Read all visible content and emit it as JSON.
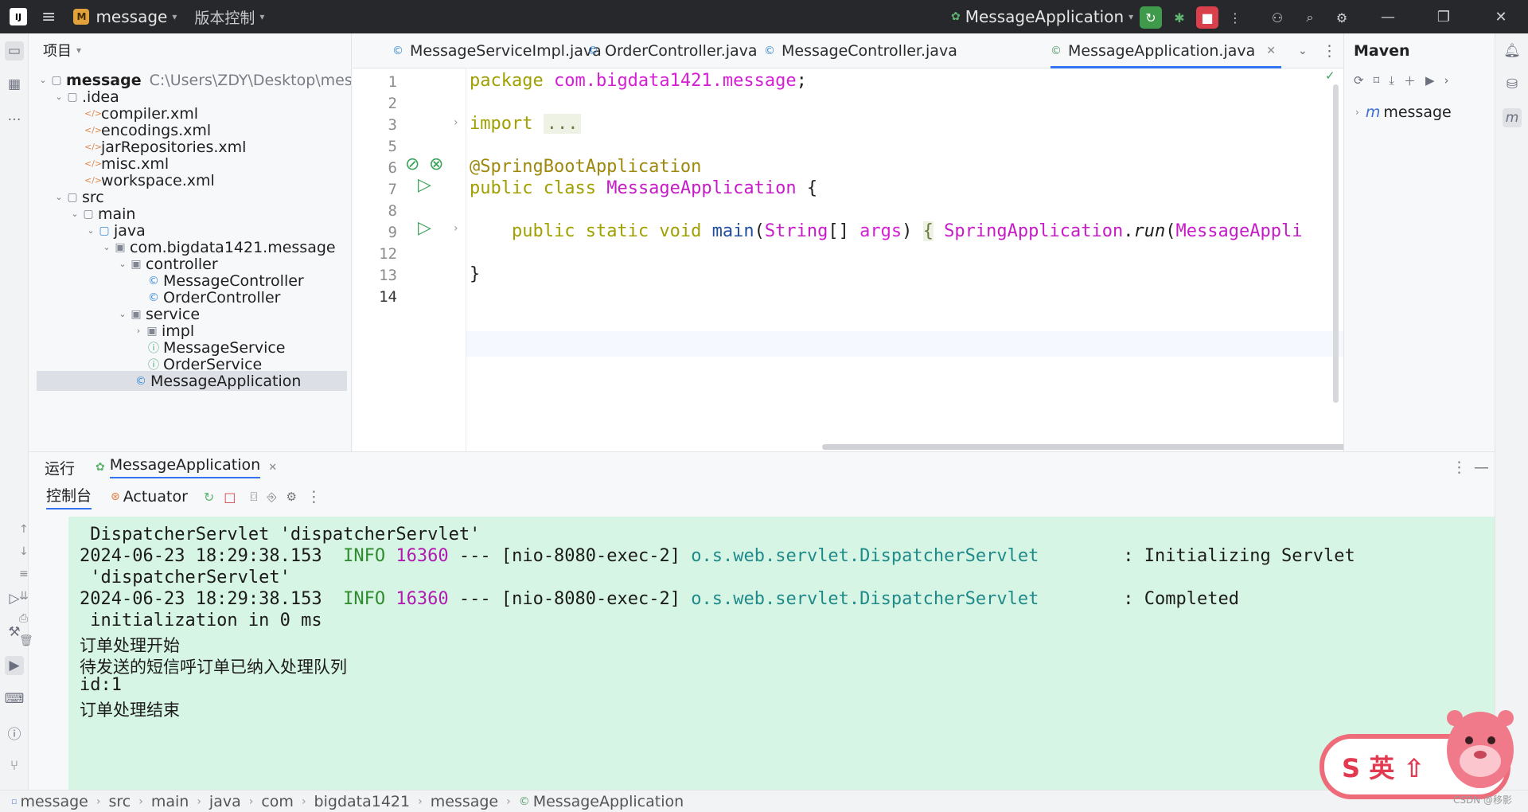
{
  "titlebar": {
    "app_logo": "IJ",
    "project_badge": "M",
    "project_name": "message",
    "vcs_label": "版本控制",
    "run_config": "MessageApplication",
    "icons": [
      "menu-icon",
      "rerun-icon",
      "debug-icon",
      "stop-icon",
      "more-icon",
      "add-user-icon",
      "search-icon",
      "settings-icon",
      "minimize-icon",
      "restore-icon",
      "close-icon"
    ]
  },
  "project": {
    "header": "项目",
    "tree": [
      {
        "label": "message",
        "path": "C:\\Users\\ZDY\\Desktop\\mes",
        "icon": "folder"
      },
      {
        "label": ".idea",
        "icon": "folder"
      },
      {
        "label": "compiler.xml",
        "icon": "xml"
      },
      {
        "label": "encodings.xml",
        "icon": "xml"
      },
      {
        "label": "jarRepositories.xml",
        "icon": "xml"
      },
      {
        "label": "misc.xml",
        "icon": "xml"
      },
      {
        "label": "workspace.xml",
        "icon": "xml"
      },
      {
        "label": "src",
        "icon": "folder"
      },
      {
        "label": "main",
        "icon": "folder"
      },
      {
        "label": "java",
        "icon": "folder"
      },
      {
        "label": "com.bigdata1421.message",
        "icon": "package"
      },
      {
        "label": "controller",
        "icon": "package"
      },
      {
        "label": "MessageController",
        "icon": "class"
      },
      {
        "label": "OrderController",
        "icon": "class"
      },
      {
        "label": "service",
        "icon": "package"
      },
      {
        "label": "impl",
        "icon": "package"
      },
      {
        "label": "MessageService",
        "icon": "interface"
      },
      {
        "label": "OrderService",
        "icon": "interface"
      },
      {
        "label": "MessageApplication",
        "icon": "class"
      }
    ]
  },
  "editor": {
    "tabs": [
      {
        "label": "MessageServiceImpl.java"
      },
      {
        "label": "OrderController.java"
      },
      {
        "label": "MessageController.java"
      },
      {
        "label": "MessageApplication.java",
        "active": true
      }
    ],
    "line_numbers": [
      "1",
      "2",
      "3",
      "5",
      "6",
      "7",
      "8",
      "9",
      "12",
      "13",
      "14"
    ],
    "code": {
      "l1_kw": "package",
      "l1_pkg": "com.bigdata1421.message",
      "l1_end": ";",
      "l3_kw": "import",
      "l3_fold": "...",
      "l6_ann": "@SpringBootApplication",
      "l7_kw": "public class",
      "l7_cls": "MessageApplication",
      "l7_end": "{",
      "l9_kw": "public static void",
      "l9_fn": "main",
      "l9_p1": "(",
      "l9_type": "String",
      "l9_p2": "[] ",
      "l9_arg": "args",
      "l9_p3": ") ",
      "l9_brace": "{",
      "l9_sp": " SpringApplication",
      "l9_dot": ".",
      "l9_run": "run",
      "l9_p4": "(",
      "l9_tail": "MessageAppli",
      "l13": "}"
    }
  },
  "maven": {
    "title": "Maven",
    "item": "message"
  },
  "run": {
    "label": "运行",
    "config_tab": "MessageApplication",
    "console_tab": "控制台",
    "actuator_tab": "Actuator",
    "console": {
      "l1": " DispatcherServlet 'dispatcherServlet'",
      "l2_ts": "2024-06-23 18:29:38.153  ",
      "l2_level": "INFO",
      "l2_pid": " 16360",
      "l2_thread": " --- [nio-8080-exec-2] ",
      "l2_logger": "o.s.web.servlet.DispatcherServlet",
      "l2_msg": "        : Initializing Servlet",
      "l3": " 'dispatcherServlet'",
      "l4_ts": "2024-06-23 18:29:38.153  ",
      "l4_level": "INFO",
      "l4_pid": " 16360",
      "l4_thread": " --- [nio-8080-exec-2] ",
      "l4_logger": "o.s.web.servlet.DispatcherServlet",
      "l4_msg": "        : Completed",
      "l5": " initialization in 0 ms",
      "l6": "订单处理开始",
      "l7": "待发送的短信呼订单已纳入处理队列",
      "l8": "id:1",
      "l9": "订单处理结束"
    }
  },
  "statusbar": {
    "crumbs": [
      "message",
      "src",
      "main",
      "java",
      "com",
      "bigdata1421",
      "message",
      "MessageApplication"
    ]
  },
  "watermark": "CSDN @移影"
}
